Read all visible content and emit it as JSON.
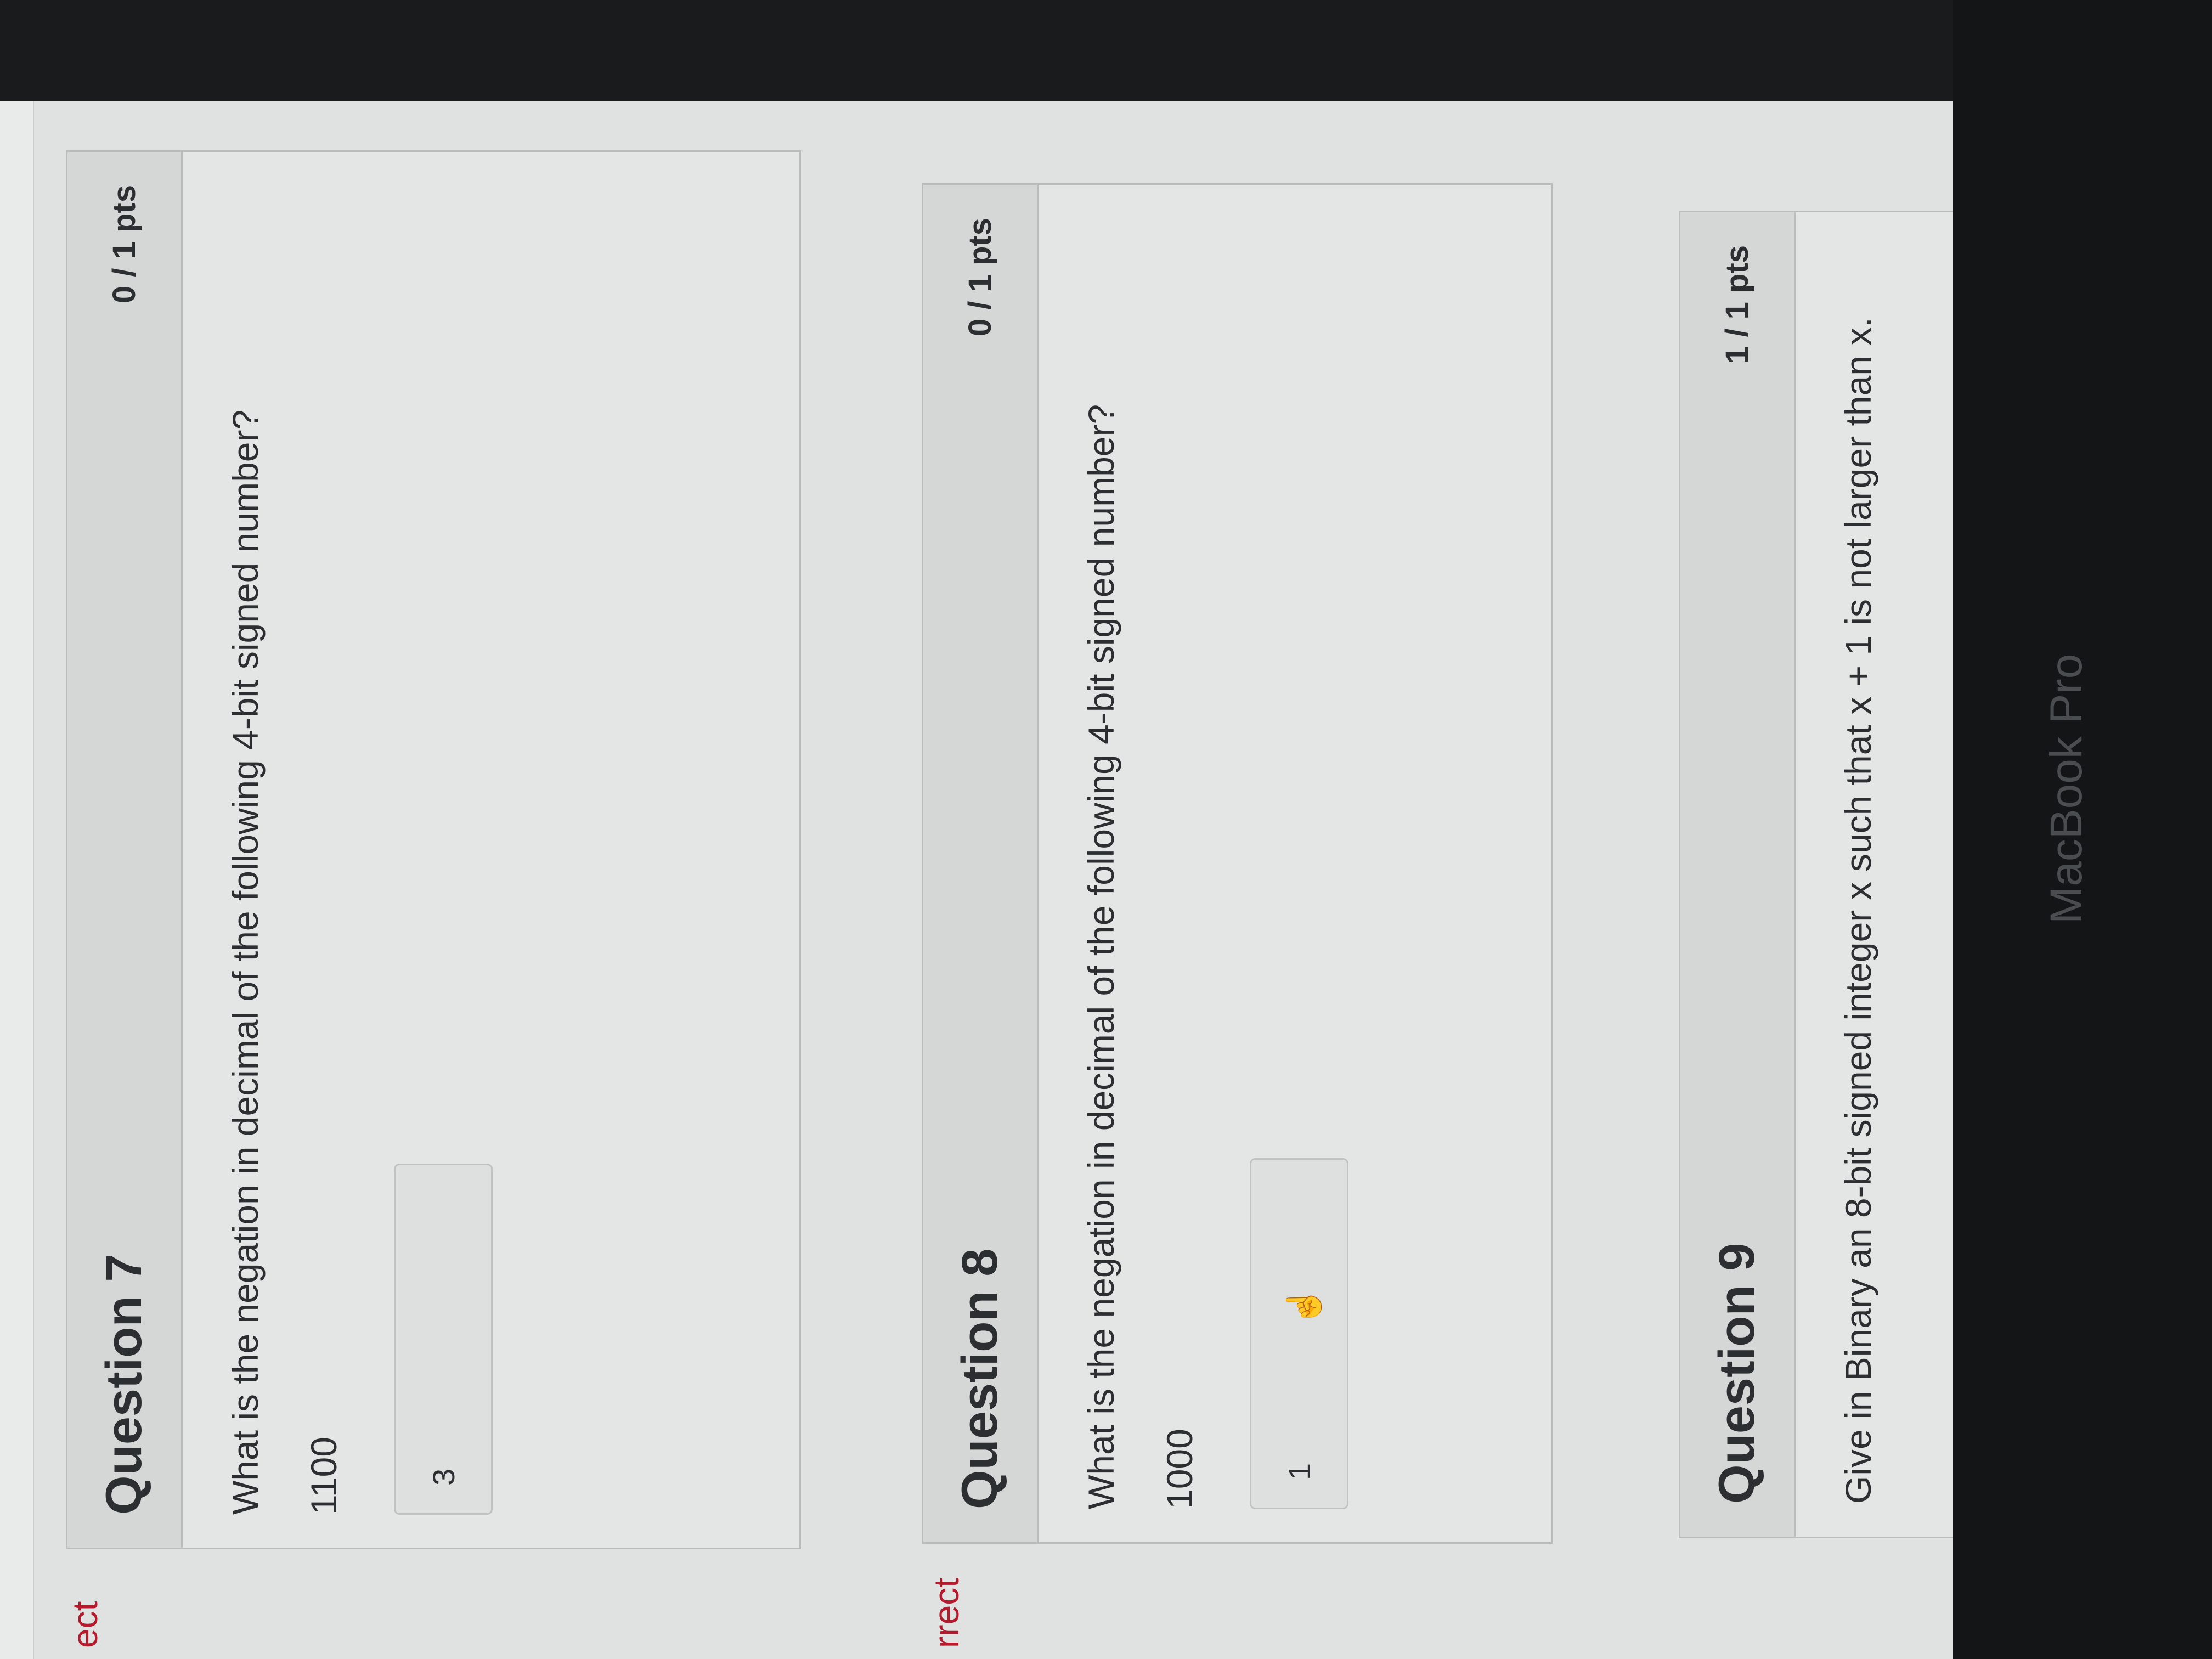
{
  "sidebar": {
    "status_top": "ect",
    "status_middle": "rrect"
  },
  "questions": [
    {
      "title": "Question 7",
      "points": "0 / 1 pts",
      "text": "What is the negation in decimal of the following 4-bit signed number?",
      "value": "1100",
      "answer": "3"
    },
    {
      "title": "Question 8",
      "points": "0 / 1 pts",
      "text": "What is the negation in decimal of the following 4-bit signed number?",
      "value": "1000",
      "answer": "1"
    },
    {
      "title": "Question 9",
      "points": "1 / 1 pts",
      "text": "Give in Binary an 8-bit signed integer x such that x + 1 is not larger than x."
    }
  ],
  "device": {
    "label": "MacBook Pro"
  },
  "icons": {
    "cursor": "pointer-hand-icon"
  },
  "colors": {
    "incorrect_flag": "#b4192c"
  }
}
